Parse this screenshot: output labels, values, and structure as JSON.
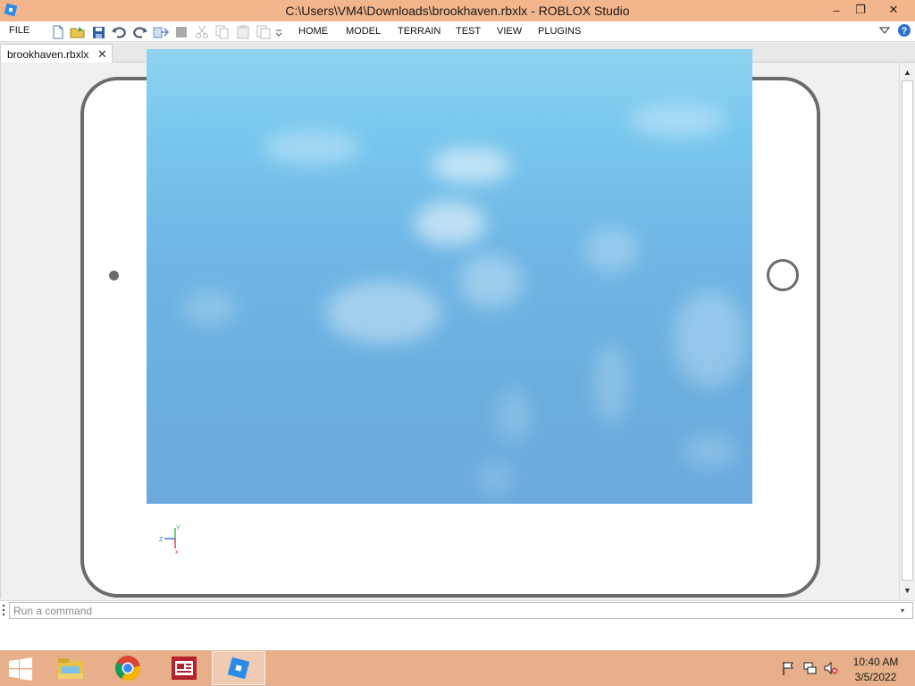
{
  "window": {
    "title": "C:\\Users\\VM4\\Downloads\\brookhaven.rbxlx - ROBLOX Studio",
    "app_icon": "roblox-studio-icon",
    "controls": {
      "minimize": "–",
      "maximize": "❐",
      "close": "✕"
    }
  },
  "menu": {
    "file_label": "FILE",
    "items": [
      {
        "label": "HOME"
      },
      {
        "label": "MODEL"
      },
      {
        "label": "TERRAIN"
      },
      {
        "label": "TEST"
      },
      {
        "label": "VIEW"
      },
      {
        "label": "PLUGINS"
      }
    ],
    "toolbar_icons": [
      "new-file-icon",
      "open-folder-icon",
      "save-icon",
      "undo-icon",
      "redo-icon",
      "publish-icon",
      "stop-icon",
      "cut-icon",
      "copy-icon",
      "paste-icon",
      "duplicate-icon",
      "toolbar-overflow-icon"
    ]
  },
  "tabs": [
    {
      "label": "brookhaven.rbxlx",
      "close": "✕"
    }
  ],
  "viewport": {
    "device_frame": "tablet",
    "sky_colors": {
      "top": "#8fd3f0",
      "bottom": "#6caade"
    },
    "axes": {
      "y": "Y",
      "z": "Z",
      "x": "x"
    }
  },
  "command_bar": {
    "placeholder": "Run a command",
    "dropdown": "▾"
  },
  "taskbar": {
    "apps": [
      "file-explorer-icon",
      "chrome-icon",
      "presentation-app-icon",
      "roblox-studio-icon"
    ],
    "active_app": "roblox-studio-icon",
    "tray": [
      "flag-icon",
      "network-icon",
      "volume-muted-icon"
    ],
    "time": "10:40 AM",
    "date": "3/5/2022"
  },
  "colors": {
    "titlebar": "#f3b58c",
    "taskbar": "#e7b08a",
    "device_frame": "#6b6b6b"
  }
}
